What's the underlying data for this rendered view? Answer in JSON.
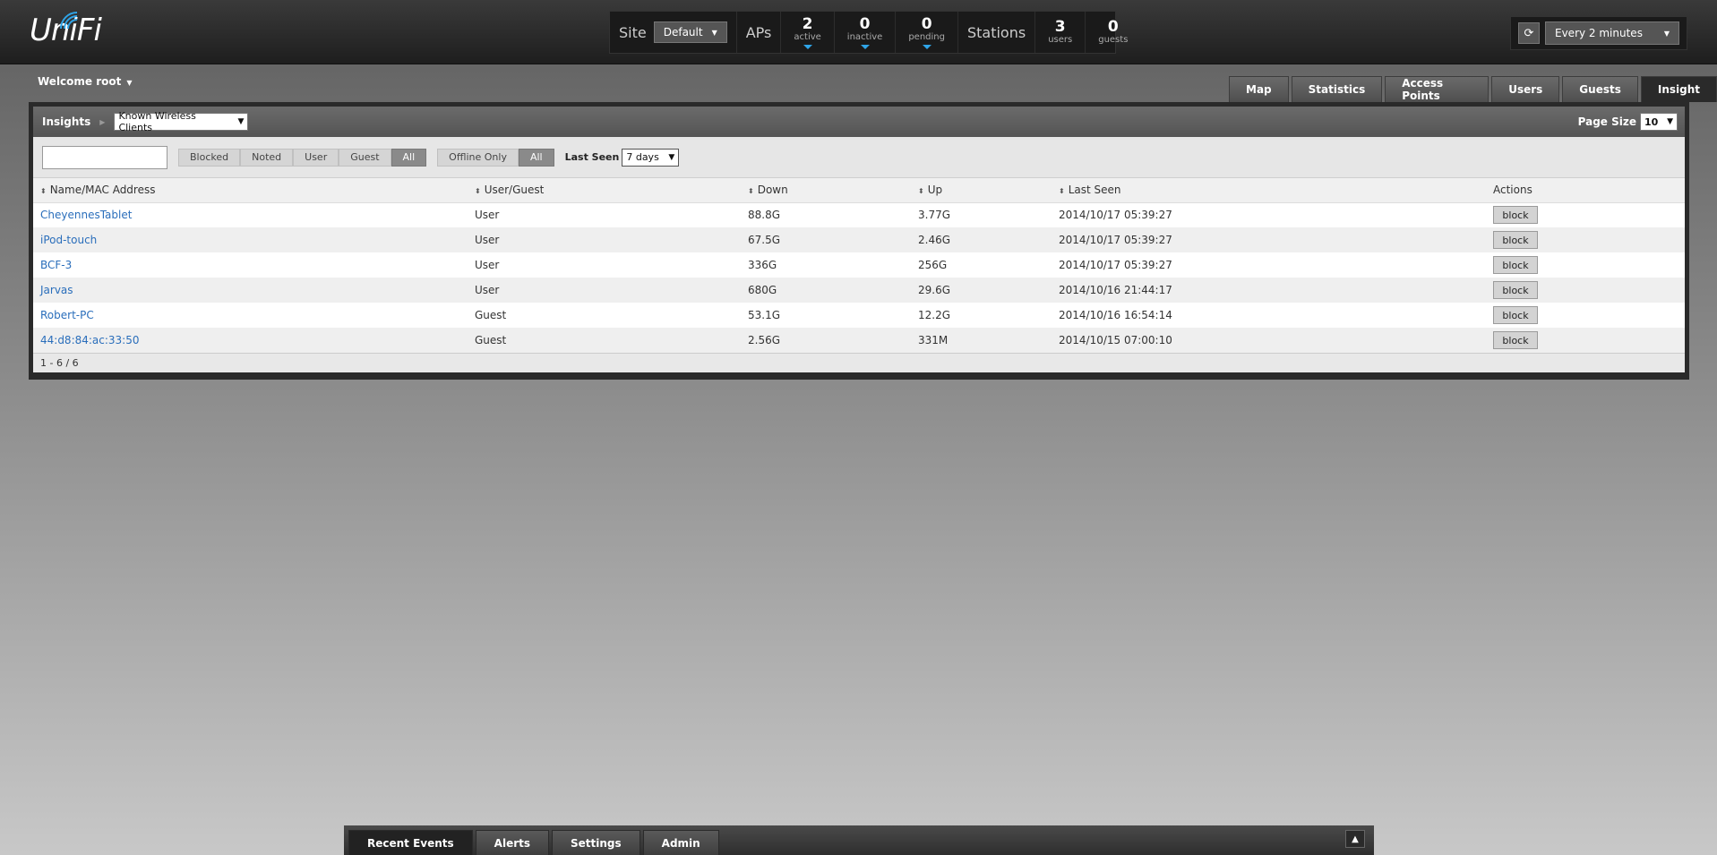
{
  "app": {
    "logo": "UniFi"
  },
  "stats": {
    "site_label": "Site",
    "site_value": "Default",
    "aps_label": "APs",
    "stations_label": "Stations",
    "items": [
      {
        "num": "2",
        "sub": "active"
      },
      {
        "num": "0",
        "sub": "inactive"
      },
      {
        "num": "0",
        "sub": "pending"
      }
    ],
    "station_items": [
      {
        "num": "3",
        "sub": "users"
      },
      {
        "num": "0",
        "sub": "guests"
      }
    ]
  },
  "refresh": {
    "interval": "Every 2 minutes"
  },
  "welcome": "Welcome root",
  "tabs": [
    "Map",
    "Statistics",
    "Access Points",
    "Users",
    "Guests",
    "Insight"
  ],
  "panel": {
    "title": "Insights",
    "view_select": "Known Wireless Clients",
    "page_size_label": "Page Size",
    "page_size": "10"
  },
  "filters": {
    "search_placeholder": "",
    "type_buttons": [
      "Blocked",
      "Noted",
      "User",
      "Guest",
      "All"
    ],
    "offline_buttons": [
      "Offline Only",
      "All"
    ],
    "last_seen_label": "Last Seen",
    "last_seen_value": "7 days"
  },
  "table": {
    "headers": [
      "Name/MAC Address",
      "User/Guest",
      "Down",
      "Up",
      "Last Seen",
      "Actions"
    ],
    "action_label": "block",
    "rows": [
      {
        "name": "CheyennesTablet",
        "type": "User",
        "down": "88.8G",
        "up": "3.77G",
        "seen": "2014/10/17 05:39:27"
      },
      {
        "name": "iPod-touch",
        "type": "User",
        "down": "67.5G",
        "up": "2.46G",
        "seen": "2014/10/17 05:39:27"
      },
      {
        "name": "BCF-3",
        "type": "User",
        "down": "336G",
        "up": "256G",
        "seen": "2014/10/17 05:39:27"
      },
      {
        "name": "Jarvas",
        "type": "User",
        "down": "680G",
        "up": "29.6G",
        "seen": "2014/10/16 21:44:17"
      },
      {
        "name": "Robert-PC",
        "type": "Guest",
        "down": "53.1G",
        "up": "12.2G",
        "seen": "2014/10/16 16:54:14"
      },
      {
        "name": "44:d8:84:ac:33:50",
        "type": "Guest",
        "down": "2.56G",
        "up": "331M",
        "seen": "2014/10/15 07:00:10"
      }
    ],
    "pager": "1 - 6 / 6"
  },
  "bottom_tabs": [
    "Recent Events",
    "Alerts",
    "Settings",
    "Admin"
  ],
  "colors": {
    "accent": "#2fa4e7",
    "link": "#2a6ebb"
  }
}
